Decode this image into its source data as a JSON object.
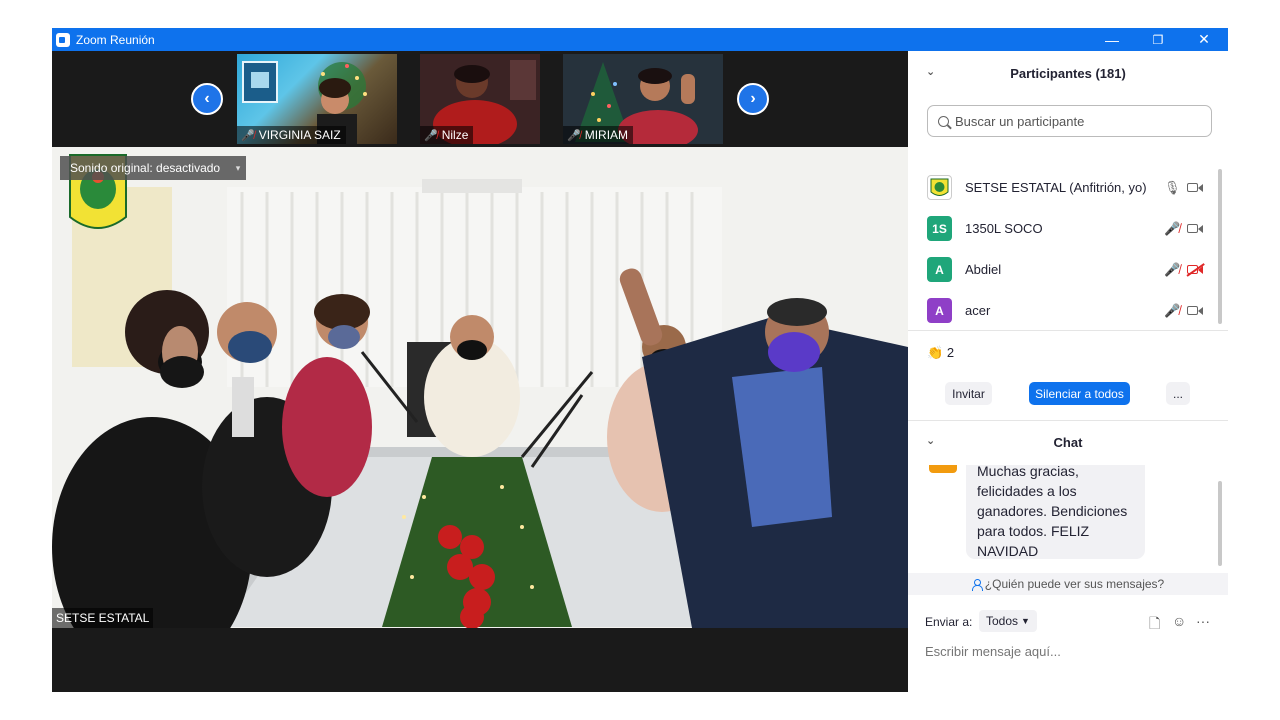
{
  "window": {
    "title": "Zoom Reunión",
    "controls": {
      "minimize": "—",
      "restore": "❐",
      "close": "✕"
    }
  },
  "gallery": {
    "prev": "‹",
    "next": "›",
    "thumbnails": [
      {
        "name": "VIRGINIA SAIZ",
        "muted": true
      },
      {
        "name": "Nilze",
        "muted": true
      },
      {
        "name": "MIRIAM",
        "muted": true
      }
    ]
  },
  "main_video": {
    "original_sound": "Sonido original: desactivado",
    "dropdown": "▾",
    "speaker": "SETSE ESTATAL"
  },
  "participants": {
    "title": "Participantes (181)",
    "search_placeholder": "Buscar un participante",
    "list": [
      {
        "initials": "",
        "name": "SETSE ESTATAL (Anfitrión, yo)",
        "avatar_color": "#f2f2c0",
        "mic": "on",
        "video": "on"
      },
      {
        "initials": "1S",
        "name": "1350L SOCO",
        "avatar_color": "#1fa67a",
        "mic": "muted",
        "video": "on"
      },
      {
        "initials": "A",
        "name": "Abdiel",
        "avatar_color": "#1fa67a",
        "mic": "muted",
        "video": "off"
      },
      {
        "initials": "A",
        "name": "acer",
        "avatar_color": "#8f3fc7",
        "mic": "muted",
        "video": "on"
      }
    ],
    "reaction": {
      "emoji": "👏",
      "count": "2"
    },
    "buttons": {
      "invite": "Invitar",
      "mute_all": "Silenciar a todos",
      "more": "..."
    }
  },
  "chat": {
    "title": "Chat",
    "messages": [
      {
        "lines": [
          "Muchas gracias,",
          "felicidades a los",
          "ganadores. Bendiciones",
          "para todos. FELIZ",
          "NAVIDAD"
        ],
        "avatar_color": "#f29b0f"
      }
    ],
    "visibility": "¿Quién puede ver sus mensajes?",
    "send_to_label": "Enviar a:",
    "recipient": "Todos",
    "input_placeholder": "Escribir mensaje aquí..."
  },
  "colors": {
    "brand_blue": "#0e72ed",
    "muted_red": "#e02828",
    "stage_bg": "#1a1a1a"
  }
}
